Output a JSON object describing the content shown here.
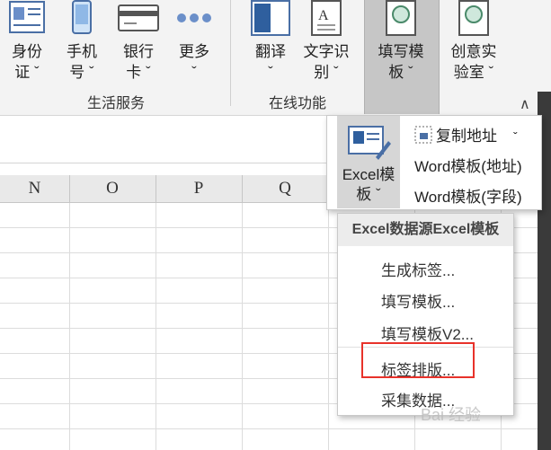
{
  "ribbon": {
    "groups": {
      "life_services": "生活服务",
      "online_functions": "在线功能"
    },
    "buttons": {
      "id_card": "身份\n证 ˇ",
      "phone": "手机\n号 ˇ",
      "bank_card": "银行\n卡 ˇ",
      "more": "更多\nˇ",
      "translate": "翻译\nˇ",
      "ocr": "文字识\n别 ˇ",
      "fill_template": "填写模\n板 ˇ",
      "creative_lab": "创意实\n验室 ˇ"
    }
  },
  "columns": [
    "N",
    "O",
    "P",
    "Q"
  ],
  "panel": {
    "excel_template": "Excel模\n板 ˇ",
    "copy_address": "复制地址",
    "word_template_address": "Word模板(地址)",
    "word_template_field": "Word模板(字段)"
  },
  "menu": {
    "header": "Excel数据源Excel模板",
    "items": [
      "生成标签...",
      "填写模板...",
      "填写模板V2...",
      "标签排版...",
      "采集数据..."
    ]
  },
  "watermark": "Bai 经验",
  "colors": {
    "highlight_box": "#e8322a",
    "ribbon_bg": "#f3f3f3",
    "active_button": "#c6c6c6"
  }
}
